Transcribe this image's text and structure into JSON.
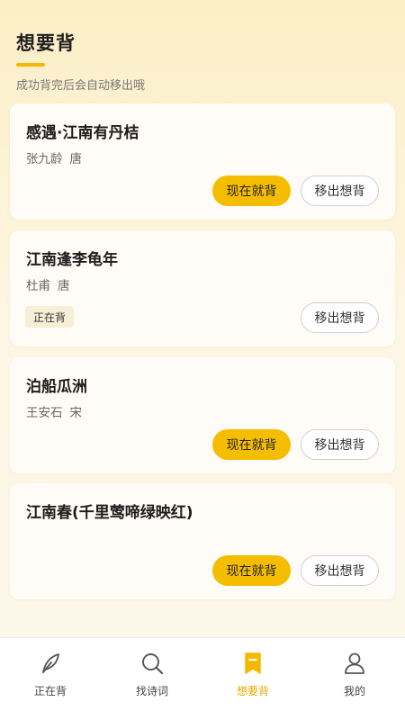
{
  "header": {
    "title": "想要背",
    "subtitle": "成功背完后会自动移出哦"
  },
  "cards": [
    {
      "title": "感遇·江南有丹桔",
      "author": "张九龄",
      "dynasty": "唐",
      "primary_button": "现在就背",
      "secondary_button": "移出想背"
    },
    {
      "title": "江南逢李龟年",
      "author": "杜甫",
      "dynasty": "唐",
      "badge": "正在背",
      "secondary_button": "移出想背"
    },
    {
      "title": "泊船瓜洲",
      "author": "王安石",
      "dynasty": "宋",
      "primary_button": "现在就背",
      "secondary_button": "移出想背"
    },
    {
      "title": "江南春(千里莺啼绿映红)",
      "primary_button": "现在就背",
      "secondary_button": "移出想背"
    }
  ],
  "tabbar": {
    "items": [
      {
        "label": "正在背",
        "icon": "feather-icon"
      },
      {
        "label": "找诗词",
        "icon": "search-icon"
      },
      {
        "label": "想要背",
        "icon": "bookmark-icon",
        "active": true
      },
      {
        "label": "我的",
        "icon": "user-icon"
      }
    ],
    "active_color": "#F5B800"
  },
  "colors": {
    "accent": "#F5BD00",
    "background": "#FDF6E3"
  }
}
